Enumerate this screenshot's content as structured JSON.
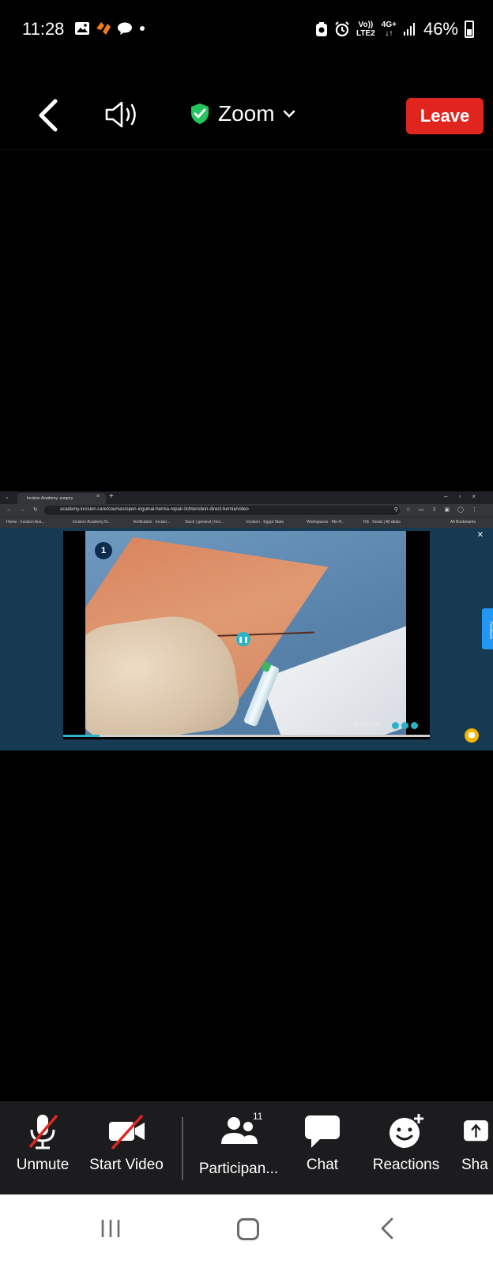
{
  "status_bar": {
    "time": "11:28",
    "network_top": "Vo))",
    "network_bottom": "LTE2",
    "gen_top": "4G+",
    "gen_bottom": "↓↑",
    "battery": "46%"
  },
  "top_bar": {
    "title": "Zoom",
    "leave_label": "Leave",
    "colors": {
      "leave": "#e0251f",
      "shield": "#22c55e"
    }
  },
  "shared_screen": {
    "tab_title": "Incision Academy: surgery",
    "url": "academy.incision.care/courses/open-inguinal-hernia-repair-lichtenstein-direct-hernia/video",
    "bookmarks": [
      "Home · Incision Aca...",
      "Incision Academy N...",
      "Verification · Incisio...",
      "Slack | general | Inci...",
      "Incision · Egypt Stats",
      "Workspaces · Mo-H...",
      "HS · Deals | All deals",
      "All Bookmarks"
    ],
    "step_number": "1",
    "watermark": "incision",
    "feedback_label": "Feedback",
    "progress_fraction": 0.1
  },
  "bottom_bar": {
    "unmute_label": "Unmute",
    "start_video_label": "Start Video",
    "participants_label": "Participan...",
    "participants_count": "11",
    "chat_label": "Chat",
    "reactions_label": "Reactions",
    "share_label": "Sha"
  }
}
